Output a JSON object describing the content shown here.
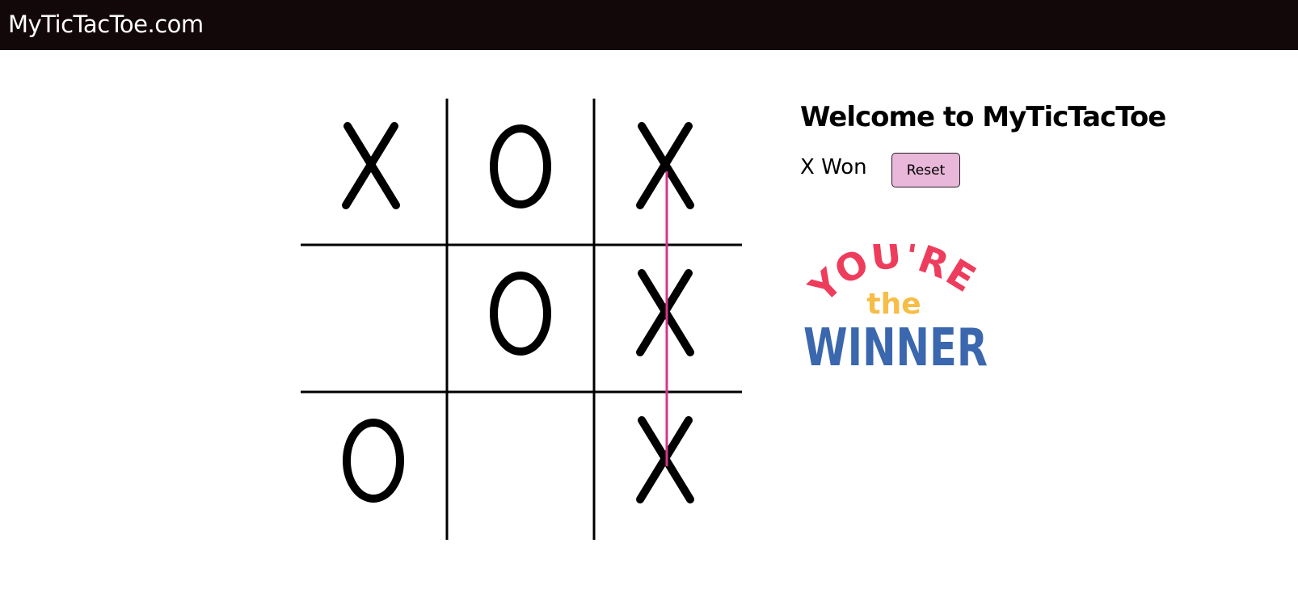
{
  "header": {
    "site_title": "MyTicTacToe.com"
  },
  "game": {
    "board": [
      [
        "X",
        "O",
        "X"
      ],
      [
        "",
        "O",
        "X"
      ],
      [
        "O",
        "",
        "X"
      ]
    ],
    "winning_line": "column-3",
    "winner": "X"
  },
  "sidebar": {
    "welcome": "Welcome to MyTicTacToe",
    "status": "X Won",
    "reset_label": "Reset",
    "badge": {
      "line1": "YOU'RE",
      "line2": "the",
      "line3": "WINNER"
    }
  },
  "colors": {
    "topbar": "#120709",
    "win_line": "#d6358b",
    "reset_button": "#e8b7d9",
    "badge_red": "#ee3d5c",
    "badge_yellow": "#f7bd46",
    "badge_blue": "#3a67ad"
  }
}
